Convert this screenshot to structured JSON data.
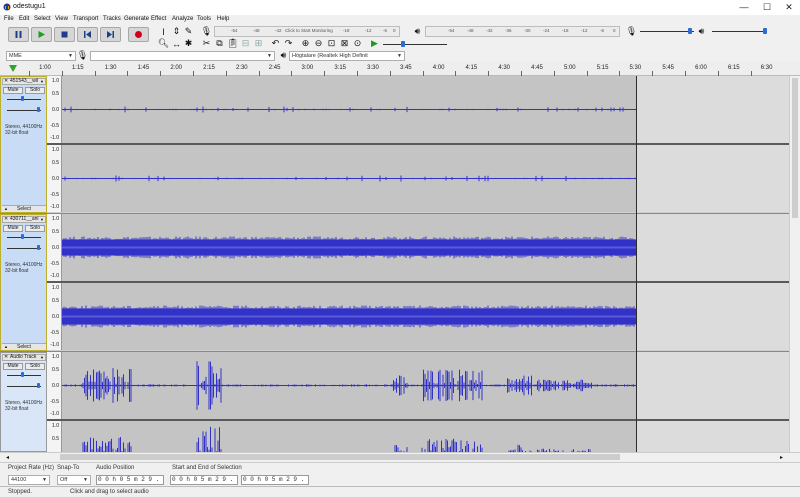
{
  "window": {
    "title": "odestugu1",
    "minimize": "—",
    "maximize": "☐",
    "close": "✕"
  },
  "menu": [
    "File",
    "Edit",
    "Select",
    "View",
    "Transport",
    "Tracks",
    "Generate",
    "Effect",
    "Analyze",
    "Tools",
    "Help"
  ],
  "transport": {
    "buttons": [
      "pause",
      "play",
      "stop",
      "skip-start",
      "skip-end",
      "record"
    ]
  },
  "meters": {
    "record_scale": [
      "-54",
      "-48",
      "-42",
      "Click to Start Monitoring",
      "-18",
      "-12",
      "-6",
      "0"
    ],
    "play_scale": [
      "-54",
      "-48",
      "-42",
      "-36",
      "-30",
      "-24",
      "-18",
      "-12",
      "-6",
      "0"
    ]
  },
  "device": {
    "host": "MME",
    "output": "Högtalare (Realtek High Definit"
  },
  "ruler": {
    "ticks": [
      "1:00",
      "1:15",
      "1:30",
      "1:45",
      "2:00",
      "2:15",
      "2:30",
      "2:45",
      "3:00",
      "3:15",
      "3:30",
      "3:45",
      "4:00",
      "4:15",
      "4:30",
      "4:45",
      "5:00",
      "5:15",
      "5:30",
      "5:45",
      "6:00",
      "6:15",
      "6:30"
    ]
  },
  "tracks": [
    {
      "name": "451543__wil",
      "mute": "Mute",
      "solo": "Solo",
      "info_line1": "Stereo, 44100Hz",
      "info_line2": "32-bit float",
      "select": "Select"
    },
    {
      "name": "430711__ani",
      "mute": "Mute",
      "solo": "Solo",
      "info_line1": "Stereo, 44100Hz",
      "info_line2": "32-bit float",
      "select": "Select"
    },
    {
      "name": "Audio Track",
      "mute": "Mute",
      "solo": "Solo",
      "info_line1": "Stereo, 44100Hz",
      "info_line2": "32-bit float",
      "select": ""
    }
  ],
  "vscale": {
    "top": "1.0",
    "mid_hi": "0.5",
    "zero": "0.0",
    "mid_lo": "-0.5",
    "bottom": "-1.0"
  },
  "selection_toolbar": {
    "project_rate_label": "Project Rate (Hz)",
    "project_rate_value": "44100",
    "snap_label": "Snap-To",
    "snap_value": "Off",
    "audio_position_label": "Audio Position",
    "audio_position_value": "0 0 h 0 5 m 2 9 . 1 7 2 s",
    "selection_label": "Start and End of Selection",
    "selection_start": "0 0 h 0 5 m 2 9 . 1 7 2 s",
    "selection_end": "0 0 h 0 5 m 2 9 . 1 7 2 s"
  },
  "status": {
    "state": "Stopped.",
    "hint": "Click and drag to select audio"
  },
  "colors": {
    "waveform": "#3232c8",
    "selected_track_border": "#bdb02c",
    "record": "#d0021b",
    "play": "#1f9d1f"
  }
}
